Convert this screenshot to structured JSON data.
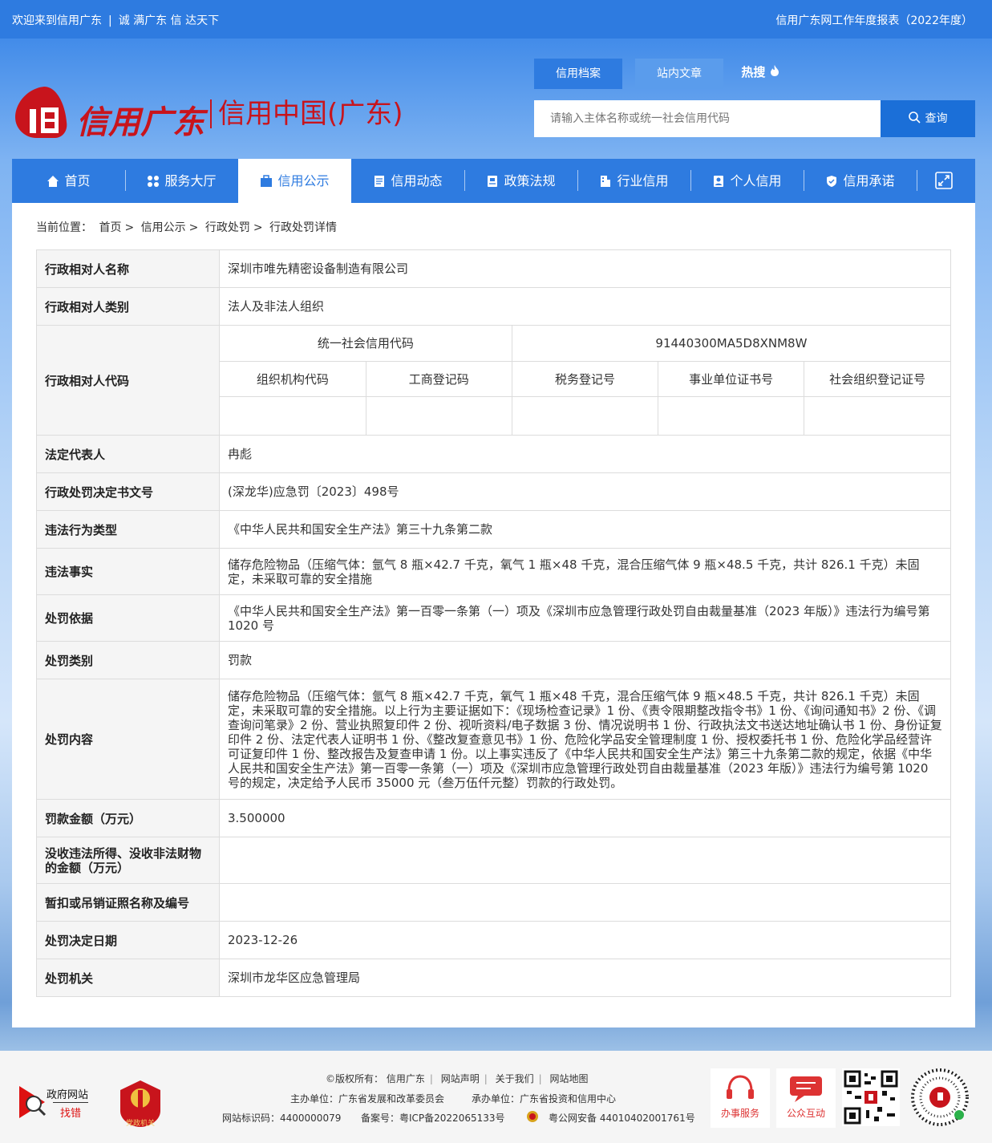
{
  "topbar": {
    "welcome": "欢迎来到信用广东",
    "slogan": "诚 满广东 信 达天下",
    "report": "信用广东网工作年度报表（2022年度）"
  },
  "logo": {
    "brand": "信用广东",
    "sub": "信用中国(广东)"
  },
  "search": {
    "tabs": [
      "信用档案",
      "站内文章"
    ],
    "hot": "热搜",
    "placeholder": "请输入主体名称或统一社会信用代码",
    "button": "查询"
  },
  "nav": {
    "items": [
      "首页",
      "服务大厅",
      "信用公示",
      "信用动态",
      "政策法规",
      "行业信用",
      "个人信用",
      "信用承诺"
    ]
  },
  "breadcrumb": {
    "prefix": "当前位置：",
    "items": [
      "首页",
      "信用公示",
      "行政处罚",
      "行政处罚详情"
    ],
    "sep": ">"
  },
  "record": {
    "name_label": "行政相对人名称",
    "name": "深圳市唯先精密设备制造有限公司",
    "type_label": "行政相对人类别",
    "type": "法人及非法人组织",
    "code_label": "行政相对人代码",
    "uscc_label": "统一社会信用代码",
    "uscc": "91440300MA5D8XNM8W",
    "code_headers": [
      "组织机构代码",
      "工商登记码",
      "税务登记号",
      "事业单位证书号",
      "社会组织登记证号"
    ],
    "legal_label": "法定代表人",
    "legal": "冉彪",
    "doc_label": "行政处罚决定书文号",
    "doc": "(深龙华)应急罚〔2023〕498号",
    "violation_type_label": "违法行为类型",
    "violation_type": "《中华人民共和国安全生产法》第三十九条第二款",
    "facts_label": "违法事实",
    "facts": "储存危险物品（压缩气体：氩气 8 瓶×42.7 千克，氧气 1 瓶×48 千克，混合压缩气体 9 瓶×48.5 千克，共计 826.1 千克）未固定，未采取可靠的安全措施",
    "basis_label": "处罚依据",
    "basis": "《中华人民共和国安全生产法》第一百零一条第（一）项及《深圳市应急管理行政处罚自由裁量基准（2023 年版）》违法行为编号第 1020 号",
    "category_label": "处罚类别",
    "category": "罚款",
    "content_label": "处罚内容",
    "content": "储存危险物品（压缩气体：氩气 8 瓶×42.7 千克，氧气 1 瓶×48 千克，混合压缩气体 9 瓶×48.5 千克，共计 826.1 千克）未固定，未采取可靠的安全措施。以上行为主要证据如下：《现场检查记录》1 份、《责令限期整改指令书》1 份、《询问通知书》2 份、《调查询问笔录》2 份、营业执照复印件 2 份、视听资料/电子数据 3 份、情况说明书 1 份、行政执法文书送达地址确认书 1 份、身份证复印件 2 份、法定代表人证明书 1 份、《整改复查意见书》1 份、危险化学品安全管理制度 1 份、授权委托书 1 份、危险化学品经营许可证复印件 1 份、整改报告及复查申请 1 份。以上事实违反了《中华人民共和国安全生产法》第三十九条第二款的规定，依据《中华人民共和国安全生产法》第一百零一条第（一）项及《深圳市应急管理行政处罚自由裁量基准（2023 年版）》违法行为编号第 1020 号的规定，决定给予人民币 35000 元（叁万伍仟元整）罚款的行政处罚。",
    "fine_label": "罚款金额（万元）",
    "fine": "3.500000",
    "confiscate_label": "没收违法所得、没收非法财物的金额（万元）",
    "confiscate": "",
    "license_label": "暂扣或吊销证照名称及编号",
    "license": "",
    "date_label": "处罚决定日期",
    "date": "2023-12-26",
    "authority_label": "处罚机关",
    "authority": "深圳市龙华区应急管理局"
  },
  "footer": {
    "gov_site": "政府网站",
    "find_error": "找错",
    "party_text": "党政机关",
    "copyright": "©版权所有：",
    "links": [
      "信用广东",
      "网站声明",
      "关于我们",
      "网站地图"
    ],
    "host": "主办单位：广东省发展和改革委员会",
    "organizer": "承办单位：广东省投资和信用中心",
    "site_id": "网站标识码：4400000079",
    "icp": "备案号：粤ICP备2022065133号",
    "police": "粤公网安备 44010402001761号",
    "service": "办事服务",
    "interact": "公众互动"
  }
}
